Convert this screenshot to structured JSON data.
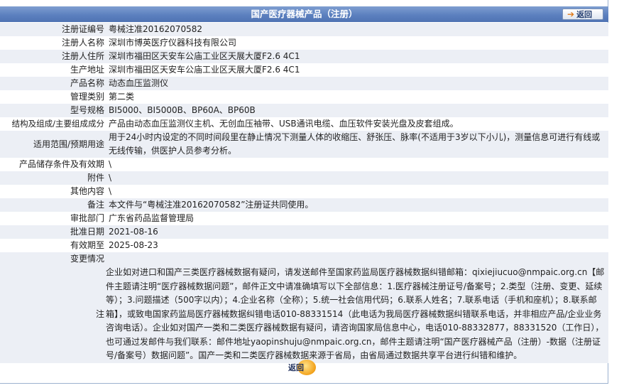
{
  "header": {
    "title": "国产医疗器械产品（注册）",
    "back_label": "返回"
  },
  "rows": [
    {
      "label": "注册证编号",
      "value": "粤械注准20162070582"
    },
    {
      "label": "注册人名称",
      "value": "深圳市博英医疗仪器科技有限公司"
    },
    {
      "label": "注册人住所",
      "value": "深圳市福田区天安车公庙工业区天展大厦F2.6 4C1"
    },
    {
      "label": "生产地址",
      "value": "深圳市福田区天安车公庙工业区天展大厦F2.6 4C1"
    },
    {
      "label": "产品名称",
      "value": "动态血压监测仪"
    },
    {
      "label": "管理类别",
      "value": "第二类"
    },
    {
      "label": "型号规格",
      "value": "BI5000、BI5000B、BP60A、BP60B"
    },
    {
      "label": "结构及组成/主要组成成分",
      "value": "产品由动态血压监测仪主机、无创血压袖带、USB通讯电缆、血压软件安装光盘及皮套组成。"
    },
    {
      "label": "适用范围/预期用途",
      "value": "用于24小时内设定的不同时间段里在静止情况下测量人体的收缩压、舒张压、脉率(不适用于3岁以下小儿)，测量信息可进行有线或无线传输，供医护人员参考分析。"
    },
    {
      "label": "产品储存条件及有效期",
      "value": "\\"
    },
    {
      "label": "附件",
      "value": "\\"
    },
    {
      "label": "其他内容",
      "value": "\\"
    },
    {
      "label": "备注",
      "value": "本文件与“粤械注准20162070582”注册证共同使用。"
    },
    {
      "label": "审批部门",
      "value": "广东省药品监督管理局"
    },
    {
      "label": "批准日期",
      "value": "2021-08-16"
    },
    {
      "label": "有效期至",
      "value": "2025-08-23"
    },
    {
      "label": "变更情况",
      "value": ""
    }
  ],
  "notice": {
    "label": "注",
    "text": "企业如对进口和国产三类医疗器械数据有疑问，请发送邮件至国家药监局医疗器械数据纠错邮箱：qixiejiucuo@nmpaic.org.cn【邮件主题请注明“医疗器械数据问题”，邮件正文中请准确填写以下全部信息：1.医疗器械注册证号/备案号；2.类型（注册、变更、延续等）；3.问题描述（500字以内）；4.企业名称（全称）；5.统一社会信用代码；6.联系人姓名；7.联系电话（手机和座机）；8.联系邮箱】，或致电国家药监局医疗器械数据纠错电话010-88331514（此电话为我局医疗器械数据纠错联系电话，并非相应产品/企业业务咨询电话）。企业如对国产一类和二类医疗器械数据有疑问，请咨询国家局信息中心，电话010-88332877，88331520（工作日），也可通过发邮件与我们联系：邮件地址yaopinshuju@nmpaic.org.cn，邮件主题请注明“国产医疗器械产品（注册）-数据（注册证号/备案号）数据问题”。国产一类和二类医疗器械数据来源于省局，由省局通过数据共享平台进行纠错和维护。"
  },
  "footer": {
    "back_label": "返回"
  }
}
